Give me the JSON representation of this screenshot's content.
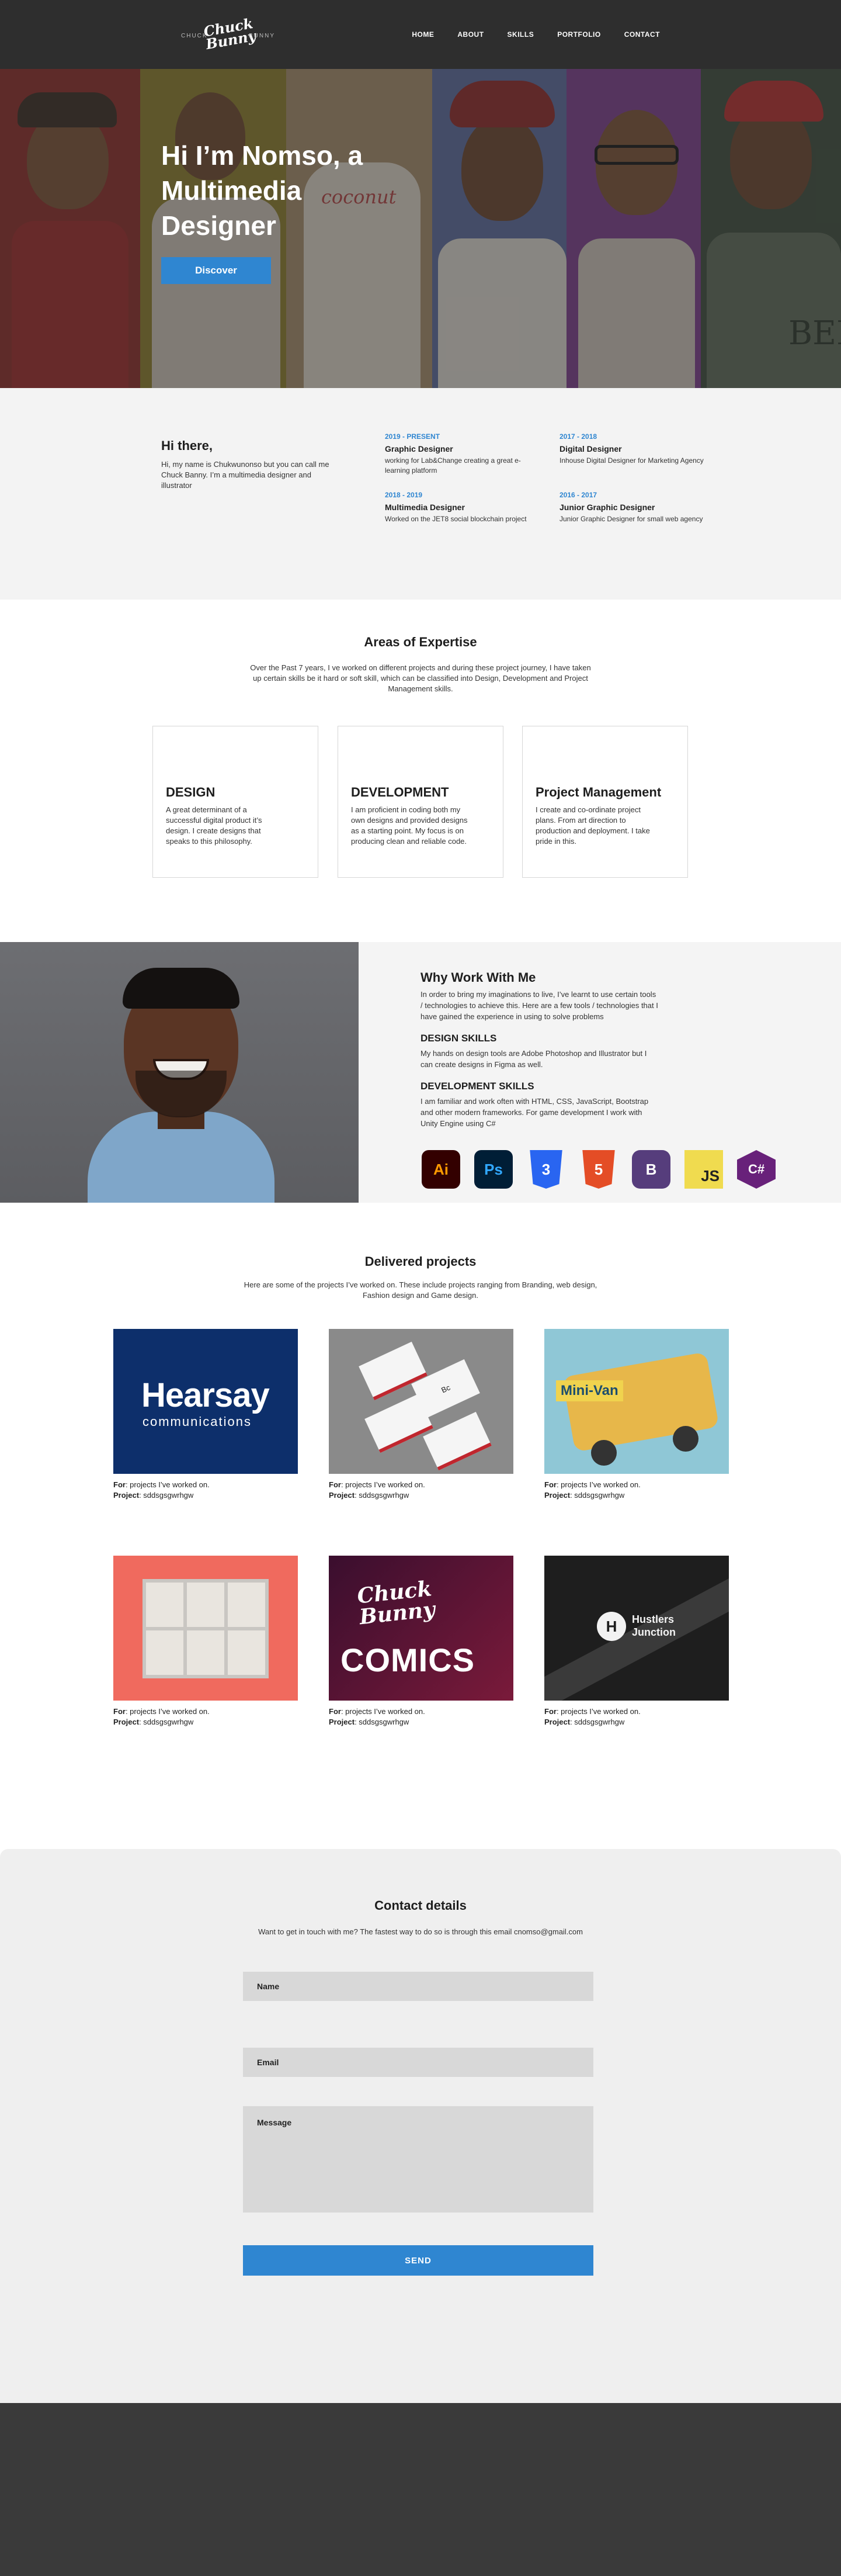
{
  "nav": {
    "logo": {
      "left": "CHUCK",
      "script": "Chuck Bunny",
      "right": "BUNNY"
    },
    "links": [
      "HOME",
      "ABOUT",
      "SKILLS",
      "PORTFOLIO",
      "CONTACT"
    ]
  },
  "hero": {
    "title": "Hi I’m Nomso, a Multimedia Designer",
    "button": "Discover",
    "shirt_text": "coconut",
    "tag_text": "BEBE"
  },
  "about": {
    "heading": "Hi there,",
    "intro": "Hi, my name is Chukwunonso but you can call me Chuck Banny. I’m a multimedia designer and illustrator",
    "timeline": [
      {
        "date": "2019 - PRESENT",
        "role": "Graphic Designer",
        "desc": "working for Lab&Change creating a great e-learning platform"
      },
      {
        "date": "2017 - 2018",
        "role": "Digital Designer",
        "desc": "Inhouse Digital Designer for Marketing Agency"
      },
      {
        "date": "2018 - 2019",
        "role": "Multimedia Designer",
        "desc": "Worked on the JET8 social blockchain project"
      },
      {
        "date": "2016 - 2017",
        "role": "Junior Graphic Designer",
        "desc": "Junior Graphic Designer for small web agency"
      }
    ]
  },
  "expertise": {
    "title": "Areas of Expertise",
    "subtitle": "Over the Past 7 years, I ve worked on different projects and during these project journey, I have taken up certain skills be it hard or soft skill, which can be classified into Design, Development and Project Management skills.",
    "cards": [
      {
        "title": "DESIGN",
        "text": "A great determinant of a successful digital product it’s design. I create designs that speaks to this philosophy."
      },
      {
        "title": "DEVELOPMENT",
        "text": "I am proficient in coding both my own designs and provided designs as a starting point. My focus is on producing clean and reliable code."
      },
      {
        "title": "Project Management",
        "text": "I create and co-ordinate project plans. From art direction to production and deployment. I take pride in this."
      }
    ]
  },
  "why": {
    "title": "Why Work With Me",
    "intro": "In order to bring my imaginations to live, I’ve learnt to use certain tools / technologies to achieve this. Here are a few tools / technologies that I have gained the experience in using to solve problems",
    "design_heading": "DESIGN SKILLS",
    "design_text": "My hands on design tools are Adobe Photoshop and Illustrator but I can create designs in Figma as well.",
    "dev_heading": "DEVELOPMENT SKILLS",
    "dev_text": "I am familiar and work often with HTML, CSS, JavaScript, Bootstrap and other modern frameworks. For game development I work with Unity Engine using C#",
    "tools": [
      {
        "name": "illustrator-icon",
        "label": "Ai",
        "color": "#ff9a00"
      },
      {
        "name": "photoshop-icon",
        "label": "Ps",
        "color": "#31a8ff"
      },
      {
        "name": "css3-icon",
        "label": "3",
        "color": "#2965f1"
      },
      {
        "name": "html5-icon",
        "label": "5",
        "color": "#e44d26"
      },
      {
        "name": "bootstrap-icon",
        "label": "B",
        "color": "#563d7c"
      },
      {
        "name": "javascript-icon",
        "label": "JS",
        "color": "#f0db4f"
      },
      {
        "name": "csharp-icon",
        "label": "C#",
        "color": "#68217a"
      }
    ]
  },
  "projects": {
    "title": "Delivered projects",
    "subtitle": "Here are some of the  projects I’ve worked on. These include projects ranging from Branding, web design, Fashion design and Game design.",
    "for_label": "For",
    "project_label": "Project",
    "items": [
      {
        "for": ":  projects I’ve worked on.",
        "project": ": sddsgsgwrhgw",
        "art": "Hearsay",
        "art2": "communications"
      },
      {
        "for": ":  projects I’ve worked on.",
        "project": ": sddsgsgwrhgw",
        "art": "Bc"
      },
      {
        "for": ":  projects I’ve worked on.",
        "project": ": sddsgsgwrhgw",
        "art": "Mini-Van"
      },
      {
        "for": ":  projects I’ve worked on.",
        "project": ": sddsgsgwrhgw",
        "art": ""
      },
      {
        "for": ":  projects I’ve worked on.",
        "project": ": sddsgsgwrhgw",
        "art": "Chuck Bunny",
        "art2": "COMICS"
      },
      {
        "for": ":  projects I’ve worked on.",
        "project": ": sddsgsgwrhgw",
        "art": "Hustlers",
        "art2": "Junction"
      }
    ]
  },
  "contact": {
    "title": "Contact details",
    "subtitle": "Want to get in touch with me? The fastest way to do so is through this email cnomso@gmail.com",
    "name_placeholder": "Name",
    "email_placeholder": "Email",
    "message_placeholder": "Message",
    "send": "SEND"
  }
}
